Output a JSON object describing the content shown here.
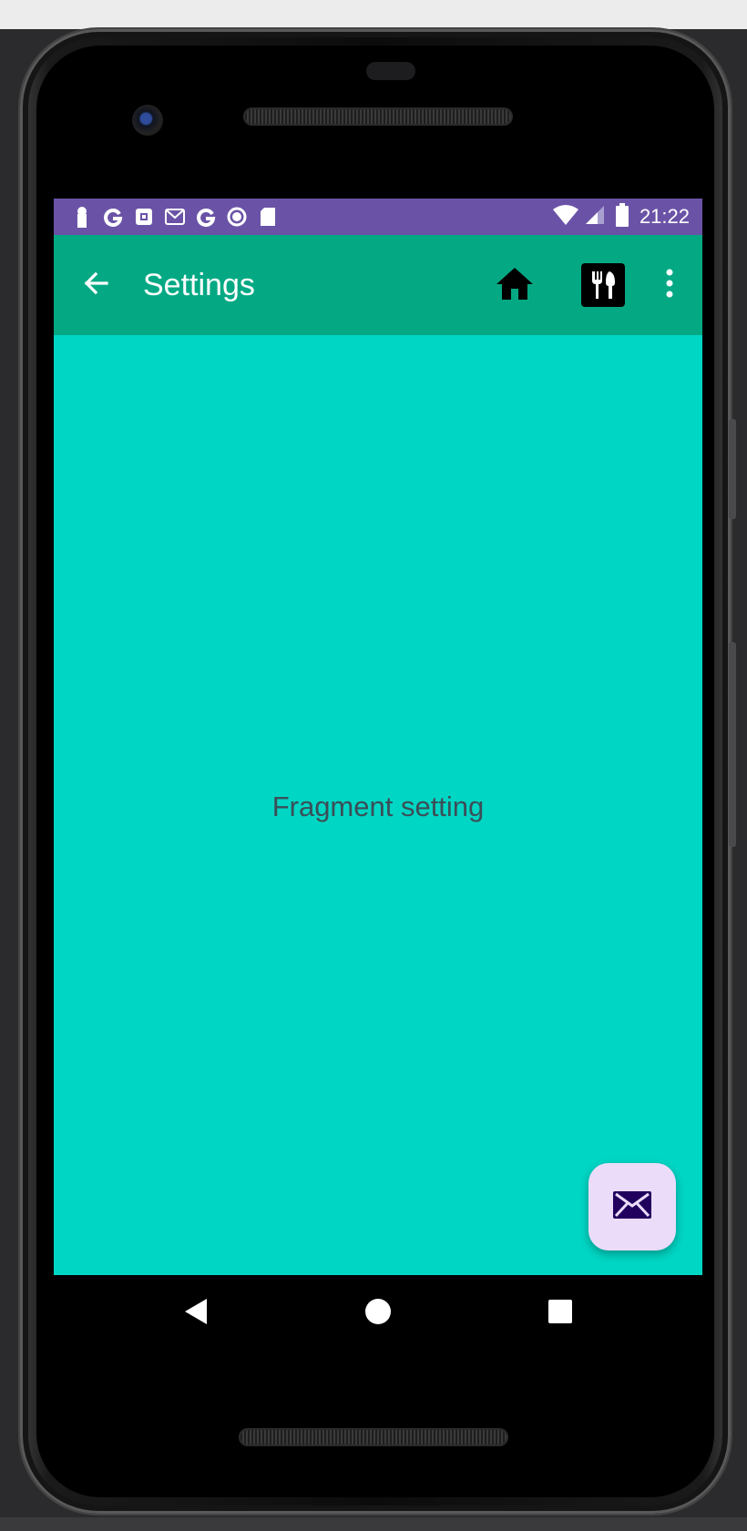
{
  "status_bar": {
    "time": "21:22",
    "left_icons": [
      "keyhole-icon",
      "google-g-icon",
      "app-notification-icon",
      "gmail-icon",
      "google-g-icon",
      "record-icon",
      "sd-card-icon"
    ],
    "right_icons": [
      "wifi-icon",
      "cellular-signal-icon",
      "battery-icon"
    ],
    "bg_color": "#6a53a6"
  },
  "app_bar": {
    "title": "Settings",
    "back_icon": "arrow-back-icon",
    "actions": [
      "home-icon",
      "restaurant-icon",
      "more-vert-icon"
    ],
    "bg_color": "#04a984"
  },
  "content": {
    "text": "Fragment setting",
    "bg_color": "#00d6c4"
  },
  "fab": {
    "icon": "email-icon",
    "bg_color": "#ebdcfa"
  },
  "nav_bar": {
    "buttons": [
      "back-triangle-icon",
      "home-circle-icon",
      "recents-square-icon"
    ]
  }
}
